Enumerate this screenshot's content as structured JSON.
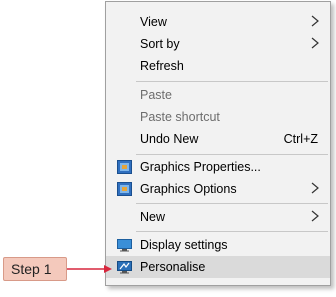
{
  "menu": {
    "view": "View",
    "sort_by": "Sort by",
    "refresh": "Refresh",
    "paste": "Paste",
    "paste_shortcut": "Paste shortcut",
    "undo_new": "Undo New",
    "undo_shortcut": "Ctrl+Z",
    "graphics_properties": "Graphics Properties...",
    "graphics_options": "Graphics Options",
    "new": "New",
    "display_settings": "Display settings",
    "personalise": "Personalise"
  },
  "annotation": {
    "step_label": "Step 1",
    "arrow_color": "#d7263d",
    "box_color": "#f4c9bc"
  },
  "icons": {
    "graphics_properties": "intel-graphics-icon",
    "graphics_options": "intel-graphics-icon",
    "display_settings": "monitor-icon",
    "personalise": "personalise-monitor-icon"
  }
}
